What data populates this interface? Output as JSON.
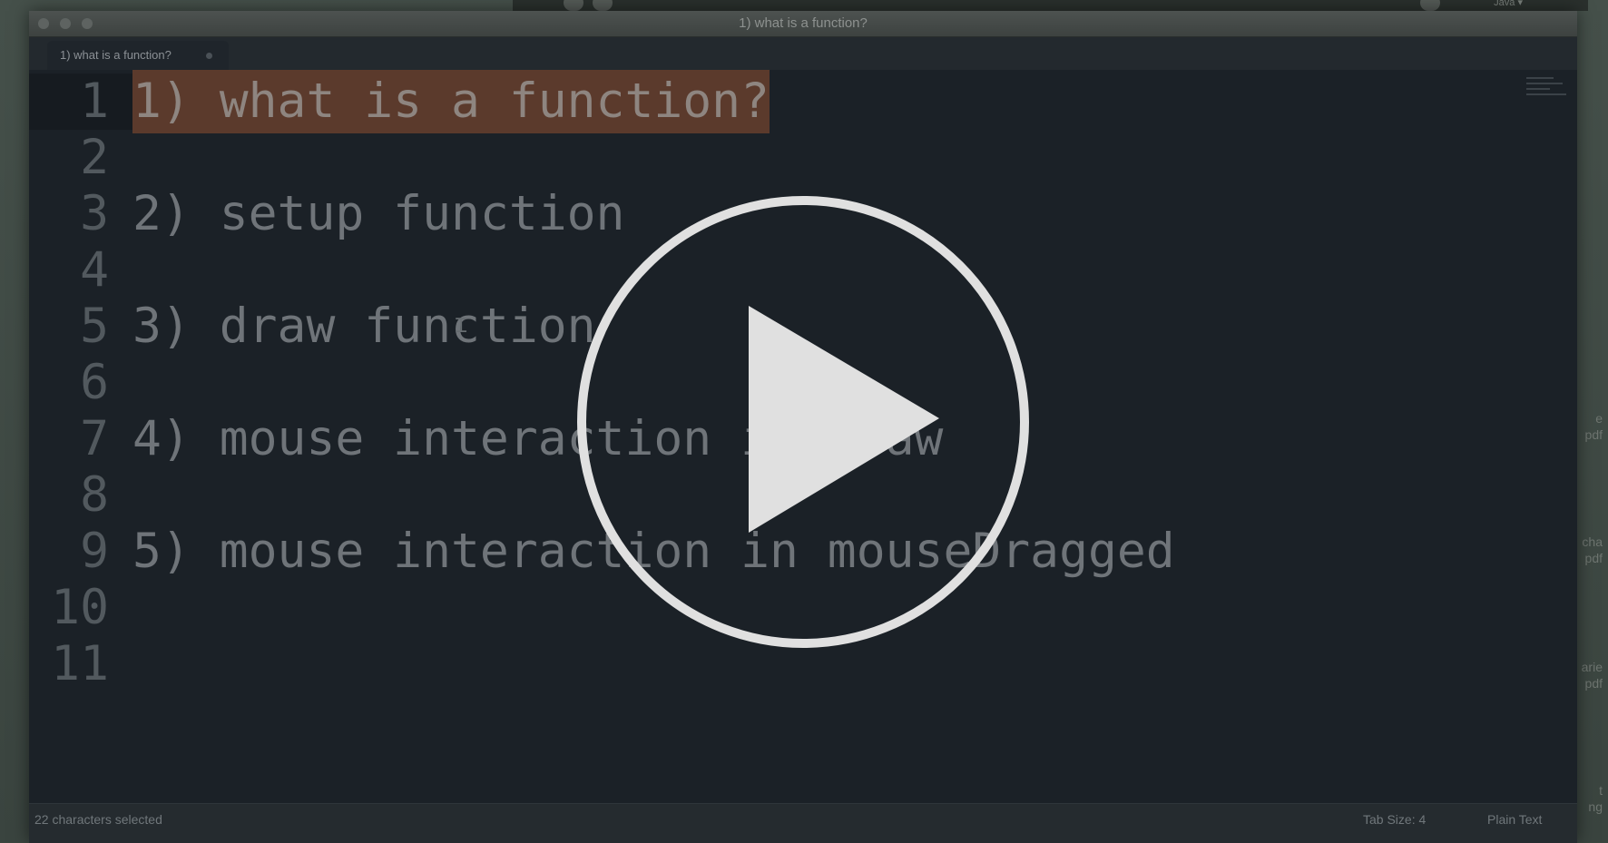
{
  "window": {
    "title": "1) what is a function?"
  },
  "background_app": {
    "language_menu": "Java ▾"
  },
  "side_labels": [
    {
      "line1": "e",
      "line2": "pdf"
    },
    {
      "line1": "cha",
      "line2": "pdf"
    },
    {
      "line1": "arie",
      "line2": "pdf"
    },
    {
      "line1": "t",
      "line2": "ng"
    }
  ],
  "tab": {
    "label": "1) what is a function?"
  },
  "editor": {
    "lines": [
      {
        "number": "1",
        "text": "1) what is a function?",
        "selected": true
      },
      {
        "number": "2",
        "text": ""
      },
      {
        "number": "3",
        "text": "2) setup function"
      },
      {
        "number": "4",
        "text": ""
      },
      {
        "number": "5",
        "text": "3) draw function"
      },
      {
        "number": "6",
        "text": ""
      },
      {
        "number": "7",
        "text": "4) mouse interaction in draw"
      },
      {
        "number": "8",
        "text": ""
      },
      {
        "number": "9",
        "text": "5) mouse interaction in mouseDragged"
      },
      {
        "number": "10",
        "text": ""
      },
      {
        "number": "11",
        "text": ""
      }
    ]
  },
  "statusbar": {
    "selection": "22 characters selected",
    "tab_size": "Tab Size: 4",
    "syntax": "Plain Text"
  },
  "icons": {
    "play": "play-icon",
    "cursor": "text-cursor-icon"
  },
  "colors": {
    "editor_bg": "#1b2127",
    "selection": "#5b3a2c",
    "play_overlay": "#e0e0e0"
  }
}
